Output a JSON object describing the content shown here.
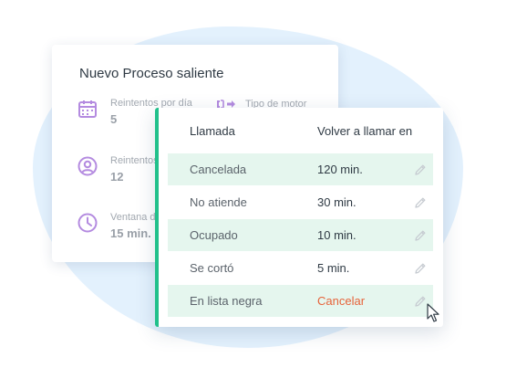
{
  "back_card": {
    "title": "Nuevo Proceso saliente",
    "params": [
      {
        "label": "Reintentos por día",
        "value": "5",
        "icon": "calendar-icon"
      },
      {
        "label": "Reintentos",
        "value": "12",
        "icon": "user-circle-icon"
      },
      {
        "label": "Ventana d",
        "value": "15 min.",
        "icon": "clock-icon"
      }
    ],
    "motor_label": "Tipo de motor",
    "motor_icon": "motor-arrow-icon"
  },
  "front_card": {
    "headers": {
      "col1": "Llamada",
      "col2": "Volver a llamar en"
    },
    "rows": [
      {
        "call": "Cancelada",
        "retry": "120 min."
      },
      {
        "call": "No atiende",
        "retry": "30 min."
      },
      {
        "call": "Ocupado",
        "retry": "10 min."
      },
      {
        "call": "Se cortó",
        "retry": "5 min."
      },
      {
        "call": "En lista negra",
        "retry": "Cancelar"
      }
    ],
    "edit_icon": "pencil-icon"
  },
  "colors": {
    "accent": "#21c08b",
    "row_highlight": "#e5f6ee",
    "icon_purple": "#b48be0",
    "cancel": "#e6633a",
    "blob": "#e3f1fd"
  }
}
